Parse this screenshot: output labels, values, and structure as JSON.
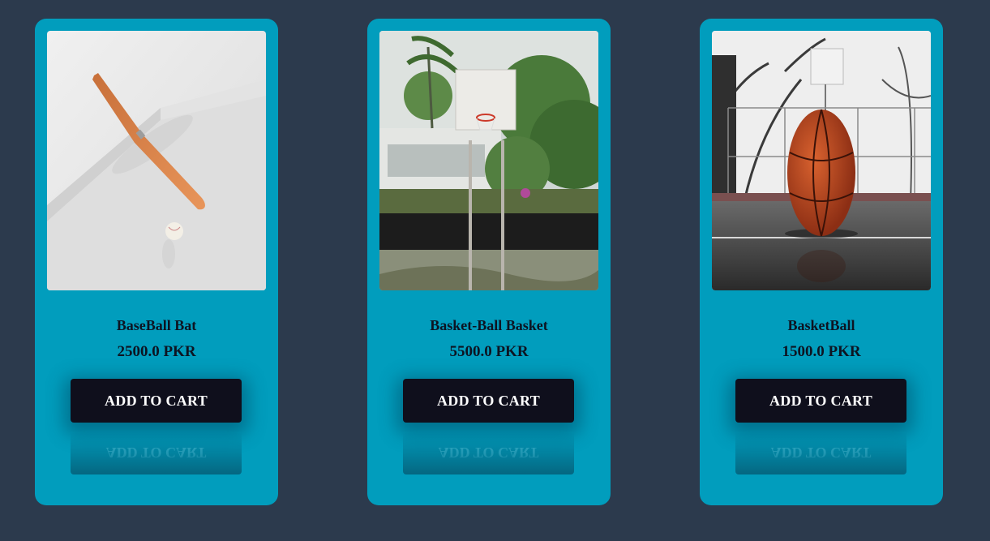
{
  "products": [
    {
      "name": "BaseBall Bat",
      "price": "2500.0 PKR",
      "button_label": "ADD TO CART",
      "image": "baseball-bat-photo"
    },
    {
      "name": "Basket-Ball Basket",
      "price": "5500.0 PKR",
      "button_label": "ADD TO CART",
      "image": "basketball-hoop-photo"
    },
    {
      "name": "BasketBall",
      "price": "1500.0 PKR",
      "button_label": "ADD TO CART",
      "image": "basketball-photo"
    }
  ],
  "colors": {
    "page_background": "#2c3a4d",
    "card_background": "#019dbd",
    "button_background": "#0f0f1c",
    "button_text": "#ffffff"
  }
}
